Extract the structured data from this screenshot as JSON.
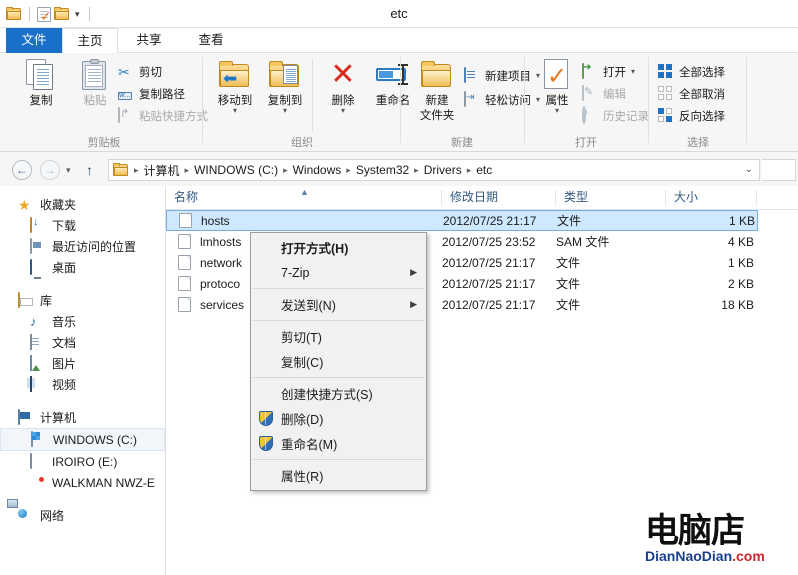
{
  "window": {
    "title": "etc"
  },
  "quick_access": {
    "items": [
      {
        "name": "folder-icon",
        "label": ""
      },
      {
        "name": "properties-icon",
        "label": ""
      },
      {
        "name": "new-folder-icon",
        "label": ""
      }
    ],
    "customize_caret": "▾"
  },
  "ribbon": {
    "tabs": [
      {
        "id": "file",
        "label": "文件"
      },
      {
        "id": "home",
        "label": "主页"
      },
      {
        "id": "share",
        "label": "共享"
      },
      {
        "id": "view",
        "label": "查看"
      }
    ],
    "active_tab": "主页",
    "groups": [
      {
        "id": "clipboard",
        "label": "剪贴板",
        "big_buttons": [
          {
            "id": "copy",
            "label": "复制"
          },
          {
            "id": "paste",
            "label": "粘贴"
          }
        ],
        "small_buttons": [
          {
            "id": "cut",
            "label": "剪切"
          },
          {
            "id": "copy-path",
            "label": "复制路径"
          },
          {
            "id": "paste-shortcut",
            "label": "粘贴快捷方式"
          }
        ]
      },
      {
        "id": "organize",
        "label": "组织",
        "big_buttons": [
          {
            "id": "move-to",
            "label": "移动到"
          },
          {
            "id": "copy-to",
            "label": "复制到"
          },
          {
            "id": "delete",
            "label": "删除"
          },
          {
            "id": "rename",
            "label": "重命名"
          }
        ]
      },
      {
        "id": "new",
        "label": "新建",
        "big_buttons": [
          {
            "id": "new-folder",
            "label": "新建",
            "label2": "文件夹"
          }
        ],
        "small_buttons": [
          {
            "id": "new-item",
            "label": "新建项目"
          },
          {
            "id": "easy-access",
            "label": "轻松访问"
          }
        ]
      },
      {
        "id": "open",
        "label": "打开",
        "big_buttons": [
          {
            "id": "properties",
            "label": "属性"
          }
        ],
        "small_buttons": [
          {
            "id": "open",
            "label": "打开"
          },
          {
            "id": "edit",
            "label": "编辑"
          },
          {
            "id": "history",
            "label": "历史记录"
          }
        ]
      },
      {
        "id": "select",
        "label": "选择",
        "small_buttons": [
          {
            "id": "select-all",
            "label": "全部选择"
          },
          {
            "id": "select-none",
            "label": "全部取消"
          },
          {
            "id": "invert-selection",
            "label": "反向选择"
          }
        ]
      }
    ]
  },
  "addressbar": {
    "back_glyph": "←",
    "forward_glyph": "→",
    "recent_glyph": "▾",
    "up_glyph": "↑",
    "separator": "▸",
    "dropdown_glyph": "⌄",
    "crumbs": [
      "计算机",
      "WINDOWS (C:)",
      "Windows",
      "System32",
      "Drivers",
      "etc"
    ]
  },
  "sidebar": {
    "items": [
      {
        "id": "favorites",
        "label": "收藏夹",
        "icon": "star-icon",
        "level": 0
      },
      {
        "id": "downloads",
        "label": "下载",
        "icon": "download-icon",
        "level": 1
      },
      {
        "id": "recent-places",
        "label": "最近访问的位置",
        "icon": "recent-places-icon",
        "level": 1
      },
      {
        "id": "desktop",
        "label": "桌面",
        "icon": "desktop-icon",
        "level": 1
      },
      {
        "id": "libraries",
        "label": "库",
        "icon": "library-icon",
        "level": 0
      },
      {
        "id": "music",
        "label": "音乐",
        "icon": "music-icon",
        "level": 1
      },
      {
        "id": "documents",
        "label": "文档",
        "icon": "document-icon",
        "level": 1
      },
      {
        "id": "pictures",
        "label": "图片",
        "icon": "picture-icon",
        "level": 1
      },
      {
        "id": "videos",
        "label": "视频",
        "icon": "video-icon",
        "level": 1
      },
      {
        "id": "computer",
        "label": "计算机",
        "icon": "computer-icon",
        "level": 0
      },
      {
        "id": "windows-c",
        "label": "WINDOWS (C:)",
        "icon": "hard-drive-icon",
        "level": 1,
        "selected": true
      },
      {
        "id": "iroiro-e",
        "label": "IROIRO (E:)",
        "icon": "removable-drive-icon",
        "level": 1
      },
      {
        "id": "walkman",
        "label": "WALKMAN NWZ-E",
        "icon": "portable-device-icon",
        "level": 1
      },
      {
        "id": "network",
        "label": "网络",
        "icon": "network-icon",
        "level": 0
      }
    ]
  },
  "filelist": {
    "columns": [
      {
        "id": "name",
        "label": "名称",
        "sorted": "asc",
        "sort_glyph": "▲"
      },
      {
        "id": "date",
        "label": "修改日期"
      },
      {
        "id": "type",
        "label": "类型"
      },
      {
        "id": "size",
        "label": "大小"
      }
    ],
    "rows": [
      {
        "name": "hosts",
        "date": "2012/07/25 21:17",
        "type": "文件",
        "size": "1 KB",
        "selected": true
      },
      {
        "name": "lmhosts",
        "date": "2012/07/25 23:52",
        "type": "SAM 文件",
        "size": "4 KB",
        "selected": false
      },
      {
        "name": "network",
        "date": "2012/07/25 21:17",
        "type": "文件",
        "size": "1 KB",
        "selected": false
      },
      {
        "name": "protoco",
        "date": "2012/07/25 21:17",
        "type": "文件",
        "size": "2 KB",
        "selected": false
      },
      {
        "name": "services",
        "date": "2012/07/25 21:17",
        "type": "文件",
        "size": "18 KB",
        "selected": false
      }
    ]
  },
  "context_menu": {
    "items": [
      {
        "id": "open-with",
        "label": "打开方式(H)",
        "bold": true,
        "submenu": false,
        "shield": false
      },
      {
        "id": "seven-zip",
        "label": "7-Zip",
        "bold": false,
        "submenu": true,
        "shield": false
      },
      {
        "id": "sep1",
        "separator": true
      },
      {
        "id": "send-to",
        "label": "发送到(N)",
        "bold": false,
        "submenu": true,
        "shield": false
      },
      {
        "id": "sep2",
        "separator": true
      },
      {
        "id": "cut",
        "label": "剪切(T)",
        "bold": false,
        "submenu": false,
        "shield": false
      },
      {
        "id": "copy",
        "label": "复制(C)",
        "bold": false,
        "submenu": false,
        "shield": false
      },
      {
        "id": "sep3",
        "separator": true
      },
      {
        "id": "create-shortcut",
        "label": "创建快捷方式(S)",
        "bold": false,
        "submenu": false,
        "shield": false
      },
      {
        "id": "delete",
        "label": "删除(D)",
        "bold": false,
        "submenu": false,
        "shield": true
      },
      {
        "id": "rename",
        "label": "重命名(M)",
        "bold": false,
        "submenu": false,
        "shield": true
      },
      {
        "id": "sep4",
        "separator": true
      },
      {
        "id": "properties",
        "label": "属性(R)",
        "bold": false,
        "submenu": false,
        "shield": false
      }
    ],
    "submenu_glyph": "▶"
  },
  "watermark": {
    "main": "电脑店",
    "domain_blue": "DianNaoDian",
    "domain_red": ".com"
  },
  "colors": {
    "accent": "#1a70c8",
    "selection": "#cde8ff",
    "header_text": "#34597f"
  }
}
